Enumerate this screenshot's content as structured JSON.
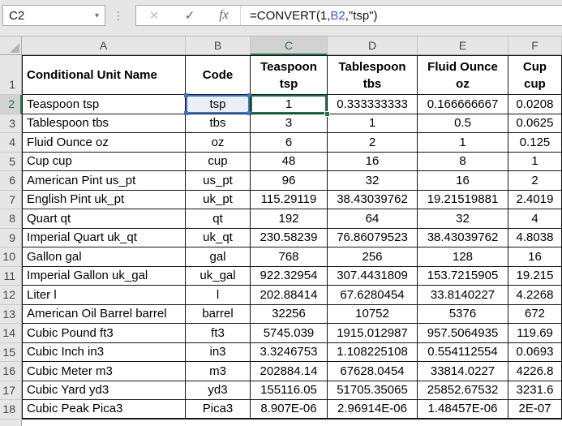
{
  "formula_bar": {
    "name_box": "C2",
    "formula": {
      "prefix": "=CONVERT(1,",
      "ref": "B2",
      "suffix": ",\"tsp\")"
    }
  },
  "icons": {
    "name_box_dropdown": "▾",
    "drag_dots": "⋮",
    "cancel": "✕",
    "enter": "✓",
    "insert_function": "fx"
  },
  "colors": {
    "selection_green": "#217346",
    "reference_blue": "#4472c4",
    "reference_fill": "#eaf0fa",
    "header_selected_bg": "#d2d2d2",
    "header_bg": "#e6e6e6"
  },
  "grid": {
    "column_letters": [
      "A",
      "B",
      "C",
      "D",
      "E",
      "F"
    ],
    "selected_column": "C",
    "selected_row": 2,
    "row_numbers": [
      1,
      2,
      3,
      4,
      5,
      6,
      7,
      8,
      9,
      10,
      11,
      12,
      13,
      14,
      15,
      16,
      17,
      18
    ],
    "active_cell": "C2",
    "referenced_cell": "B2"
  },
  "table": {
    "headers": [
      "Conditional Unit Name",
      "Code",
      "Teaspoon\ntsp",
      "Tablespoon\ntbs",
      "Fluid Ounce\noz",
      "Cup\ncup"
    ],
    "rows": [
      [
        "Teaspoon tsp",
        "tsp",
        "1",
        "0.333333333",
        "0.166666667",
        "0.0208"
      ],
      [
        "Tablespoon tbs",
        "tbs",
        "3",
        "1",
        "0.5",
        "0.0625"
      ],
      [
        "Fluid Ounce oz",
        "oz",
        "6",
        "2",
        "1",
        "0.125"
      ],
      [
        "Cup cup",
        "cup",
        "48",
        "16",
        "8",
        "1"
      ],
      [
        "American Pint us_pt",
        "us_pt",
        "96",
        "32",
        "16",
        "2"
      ],
      [
        "English Pint uk_pt",
        "uk_pt",
        "115.29119",
        "38.43039762",
        "19.21519881",
        "2.4019"
      ],
      [
        "Quart qt",
        "qt",
        "192",
        "64",
        "32",
        "4"
      ],
      [
        "Imperial Quart uk_qt",
        "uk_qt",
        "230.58239",
        "76.86079523",
        "38.43039762",
        "4.8038"
      ],
      [
        "Gallon gal",
        "gal",
        "768",
        "256",
        "128",
        "16"
      ],
      [
        "Imperial Gallon uk_gal",
        "uk_gal",
        "922.32954",
        "307.4431809",
        "153.7215905",
        "19.215"
      ],
      [
        "Liter l",
        "l",
        "202.88414",
        "67.6280454",
        "33.8140227",
        "4.2268"
      ],
      [
        "American Oil Barrel barrel",
        "barrel",
        "32256",
        "10752",
        "5376",
        "672"
      ],
      [
        "Cubic Pound ft3",
        "ft3",
        "5745.039",
        "1915.012987",
        "957.5064935",
        "119.69"
      ],
      [
        "Cubic Inch in3",
        "in3",
        "3.3246753",
        "1.108225108",
        "0.554112554",
        "0.0693"
      ],
      [
        "Cubic Meter m3",
        "m3",
        "202884.14",
        "67628.0454",
        "33814.0227",
        "4226.8"
      ],
      [
        "Cubic Yard yd3",
        "yd3",
        "155116.05",
        "51705.35065",
        "25852.67532",
        "3231.6"
      ],
      [
        "Cubic Peak Pica3",
        "Pica3",
        "8.907E-06",
        "2.96914E-06",
        "1.48457E-06",
        "2E-07"
      ]
    ]
  }
}
